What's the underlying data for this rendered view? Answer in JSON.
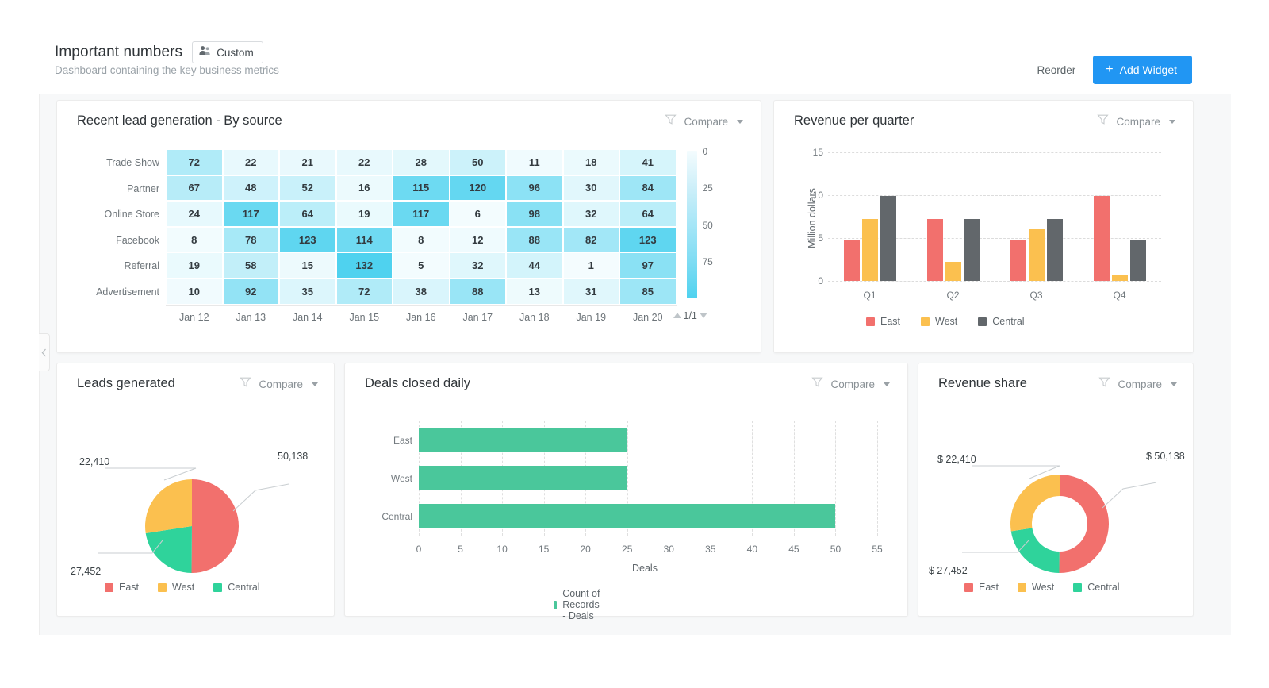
{
  "header": {
    "title": "Important numbers",
    "badge_label": "Custom",
    "badge_icon": "users-icon",
    "subtitle": "Dashboard containing the key business metrics",
    "reorder_label": "Reorder",
    "add_widget_label": "Add Widget",
    "add_widget_icon": "plus-icon",
    "accent_color": "#2196f3"
  },
  "common": {
    "compare_label": "Compare",
    "filter_icon": "filter-icon",
    "caret_icon": "chevron-down-icon"
  },
  "colors": {
    "east": "#f2706d",
    "west": "#fbc04f",
    "central": "#2fd39b",
    "gray": "#62676b",
    "heat": "#4fd2ef",
    "bar_green": "#4ac79b"
  },
  "widgets": {
    "heatmap": {
      "title": "Recent lead generation - By source",
      "rows": [
        "Trade Show",
        "Partner",
        "Online Store",
        "Facebook",
        "Referral",
        "Advertisement"
      ],
      "columns": [
        "Jan 12",
        "Jan 13",
        "Jan 14",
        "Jan 15",
        "Jan 16",
        "Jan 17",
        "Jan 18",
        "Jan 19",
        "Jan 20"
      ],
      "values": [
        [
          72,
          22,
          21,
          22,
          28,
          50,
          11,
          18,
          41
        ],
        [
          67,
          48,
          52,
          16,
          115,
          120,
          96,
          30,
          84
        ],
        [
          24,
          117,
          64,
          19,
          117,
          6,
          98,
          32,
          64
        ],
        [
          8,
          78,
          123,
          114,
          8,
          12,
          88,
          82,
          123
        ],
        [
          19,
          58,
          15,
          132,
          5,
          32,
          44,
          1,
          97
        ],
        [
          10,
          92,
          35,
          72,
          38,
          88,
          13,
          31,
          85
        ]
      ],
      "scale_labels": [
        "0",
        "25",
        "50",
        "75"
      ],
      "pager_label": "1/1"
    },
    "revenue_quarter": {
      "title": "Revenue per quarter",
      "chart_data": {
        "type": "bar",
        "title": "Revenue per quarter",
        "categories": [
          "Q1",
          "Q2",
          "Q3",
          "Q4"
        ],
        "series": [
          {
            "name": "East",
            "color": "#f2706d",
            "values": [
              4.8,
              7.2,
              4.8,
              9.9
            ]
          },
          {
            "name": "West",
            "color": "#fbc04f",
            "values": [
              7.2,
              2.2,
              6.1,
              0.7
            ]
          },
          {
            "name": "Central",
            "color": "#62676b",
            "values": [
              9.9,
              7.2,
              7.2,
              4.8
            ]
          }
        ],
        "xlabel": "",
        "ylabel": "Million dollars",
        "yticks": [
          0,
          5,
          10,
          15
        ],
        "ylim": [
          0,
          15
        ],
        "grid": true,
        "legend": "bottom"
      }
    },
    "leads_generated": {
      "title": "Leads generated",
      "chart_data": {
        "type": "pie",
        "title": "Leads generated",
        "labels": [
          "East",
          "West",
          "Central"
        ],
        "values": [
          50138,
          22410,
          27452
        ],
        "display_labels": [
          "50,138",
          "22,410",
          "27,452"
        ],
        "colors": [
          "#f2706d",
          "#2fd39b",
          "#fbc04f"
        ],
        "legend": "bottom",
        "legend_order": [
          "East",
          "West",
          "Central"
        ]
      }
    },
    "deals_closed": {
      "title": "Deals closed daily",
      "chart_data": {
        "type": "bar",
        "orientation": "horizontal",
        "title": "Deals closed daily",
        "categories": [
          "East",
          "West",
          "Central"
        ],
        "values": [
          25,
          25,
          50
        ],
        "series_name": "Count of Records - Deals",
        "color": "#4ac79b",
        "xlabel": "Deals",
        "ylabel": "",
        "xticks": [
          0,
          5,
          10,
          15,
          20,
          25,
          30,
          35,
          40,
          45,
          50,
          55
        ],
        "xlim": [
          0,
          55
        ],
        "grid": true,
        "legend": "bottom"
      }
    },
    "revenue_share": {
      "title": "Revenue share",
      "chart_data": {
        "type": "pie",
        "variant": "donut",
        "title": "Revenue share",
        "labels": [
          "East",
          "West",
          "Central"
        ],
        "values": [
          50138,
          22410,
          27452
        ],
        "display_labels": [
          "$ 50,138",
          "$ 22,410",
          "$ 27,452"
        ],
        "colors": [
          "#f2706d",
          "#2fd39b",
          "#fbc04f"
        ],
        "legend": "bottom",
        "legend_order": [
          "East",
          "West",
          "Central"
        ]
      }
    }
  }
}
